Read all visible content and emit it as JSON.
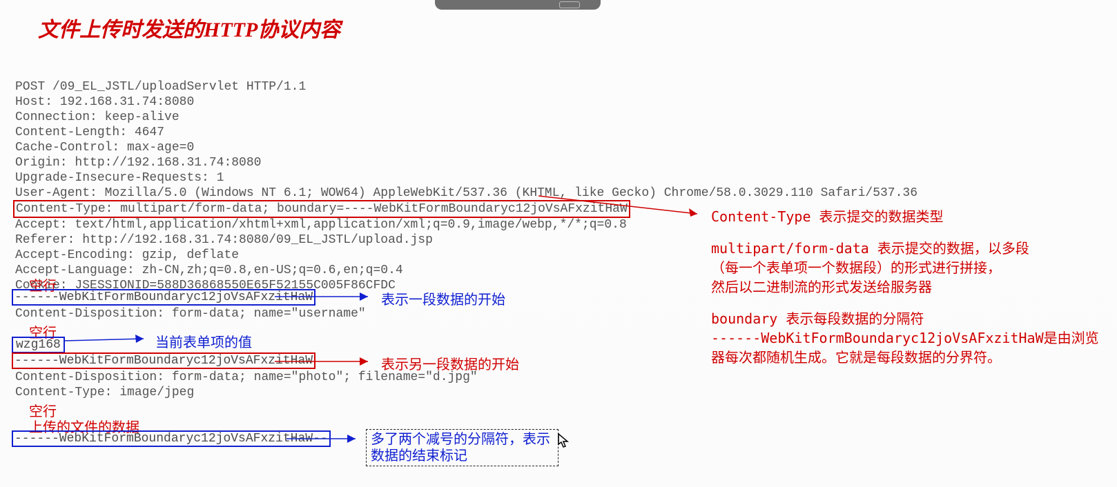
{
  "title": "文件上传时发送的HTTP协议内容",
  "http": {
    "l1": "POST /09_EL_JSTL/uploadServlet HTTP/1.1",
    "l2": "Host: 192.168.31.74:8080",
    "l3": "Connection: keep-alive",
    "l4": "Content-Length: 4647",
    "l5": "Cache-Control: max-age=0",
    "l6": "Origin: http://192.168.31.74:8080",
    "l7": "Upgrade-Insecure-Requests: 1",
    "l8": "User-Agent: Mozilla/5.0 (Windows NT 6.1; WOW64) AppleWebKit/537.36 (KHTML, like Gecko) Chrome/58.0.3029.110 Safari/537.36",
    "l9": "Content-Type: multipart/form-data; boundary=----WebKitFormBoundaryc12joVsAFxzitHaW",
    "l10": "Accept: text/html,application/xhtml+xml,application/xml;q=0.9,image/webp,*/*;q=0.8",
    "l11": "Referer: http://192.168.31.74:8080/09_EL_JSTL/upload.jsp",
    "l12": "Accept-Encoding: gzip, deflate",
    "l13": "Accept-Language: zh-CN,zh;q=0.8,en-US;q=0.6,en;q=0.4",
    "l14": "Cookie: JSESSIONID=588D36868550E65F52155C005F86CFDC",
    "b1": "------WebKitFormBoundaryc12joVsAFxzitHaW",
    "cd1": "Content-Disposition: form-data; name=\"username\"",
    "val1": "wzg168",
    "b2": "------WebKitFormBoundaryc12joVsAFxzitHaW",
    "cd2": "Content-Disposition: form-data; name=\"photo\"; filename=\"d.jpg\"",
    "ct2": "Content-Type: image/jpeg",
    "b3": "------WebKitFormBoundaryc12joVsAFxzitHaW--"
  },
  "anno": {
    "empty": "空行",
    "start1": "表示一段数据的开始",
    "value": "当前表单项的值",
    "start2": "表示另一段数据的开始",
    "uploaded": "上传的文件的数据",
    "end": "多了两个减号的分隔符，表示数据的结束标记"
  },
  "side": {
    "p1": "Content-Type 表示提交的数据类型",
    "p2a": "multipart/form-data 表示提交的数据，以多段",
    "p2b": "（每一个表单项一个数据段）的形式进行拼接，",
    "p2c": "然后以二进制流的形式发送给服务器",
    "p3a": "boundary 表示每段数据的分隔符",
    "p3b": "------WebKitFormBoundaryc12joVsAFxzitHaW是由浏览器每次都随机生成。它就是每段数据的分界符。"
  }
}
